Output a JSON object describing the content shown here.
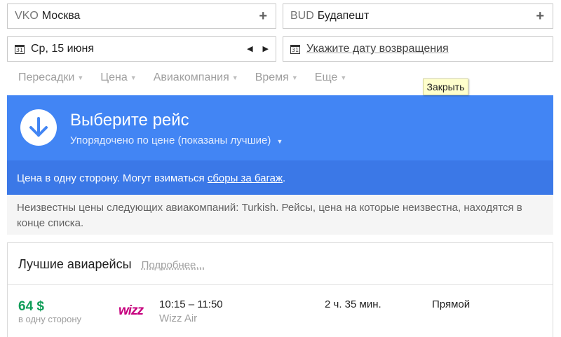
{
  "search": {
    "origin": {
      "code": "VKO",
      "city": "Москва"
    },
    "destination": {
      "code": "BUD",
      "city": "Будапешт"
    },
    "plus_glyph": "+",
    "calendar_day": "31",
    "depart_date": "Ср, 15 июня",
    "prev_glyph": "◀",
    "next_glyph": "▶",
    "return_placeholder": "Укажите дату возвращения"
  },
  "filters": [
    {
      "label": "Пересадки"
    },
    {
      "label": "Цена"
    },
    {
      "label": "Авиакомпания"
    },
    {
      "label": "Время"
    },
    {
      "label": "Еще"
    }
  ],
  "caret_glyph": "▼",
  "tooltip": {
    "text": "Закрыть"
  },
  "banner": {
    "title": "Выберите рейс",
    "sort_label": "Упорядочено по цене (показаны лучшие)",
    "bg_color": "#4285f4",
    "icon": "down-arrow-circle-icon"
  },
  "notice": {
    "text_before": "Цена в одну сторону. Могут взиматься ",
    "link": "сборы за багаж",
    "text_after": ".",
    "unknown_prices": "Неизвестны цены следующих авиакомпаний: Turkish. Рейсы, цена на которые неизвестна, находятся в конце списка."
  },
  "results": {
    "title": "Лучшие авиарейсы",
    "more_link": "Подробнее...",
    "flights": [
      {
        "price": "64 $",
        "price_note": "в одну сторону",
        "times": "10:15 – 11:50",
        "airline": "Wizz Air",
        "logo_text": "wizz",
        "duration": "2 ч. 35 мин.",
        "stops": "Прямой"
      }
    ]
  },
  "colors": {
    "price_green": "#0f9d58",
    "brand_blue": "#4285f4",
    "wizz_purple": "#c6007e"
  }
}
